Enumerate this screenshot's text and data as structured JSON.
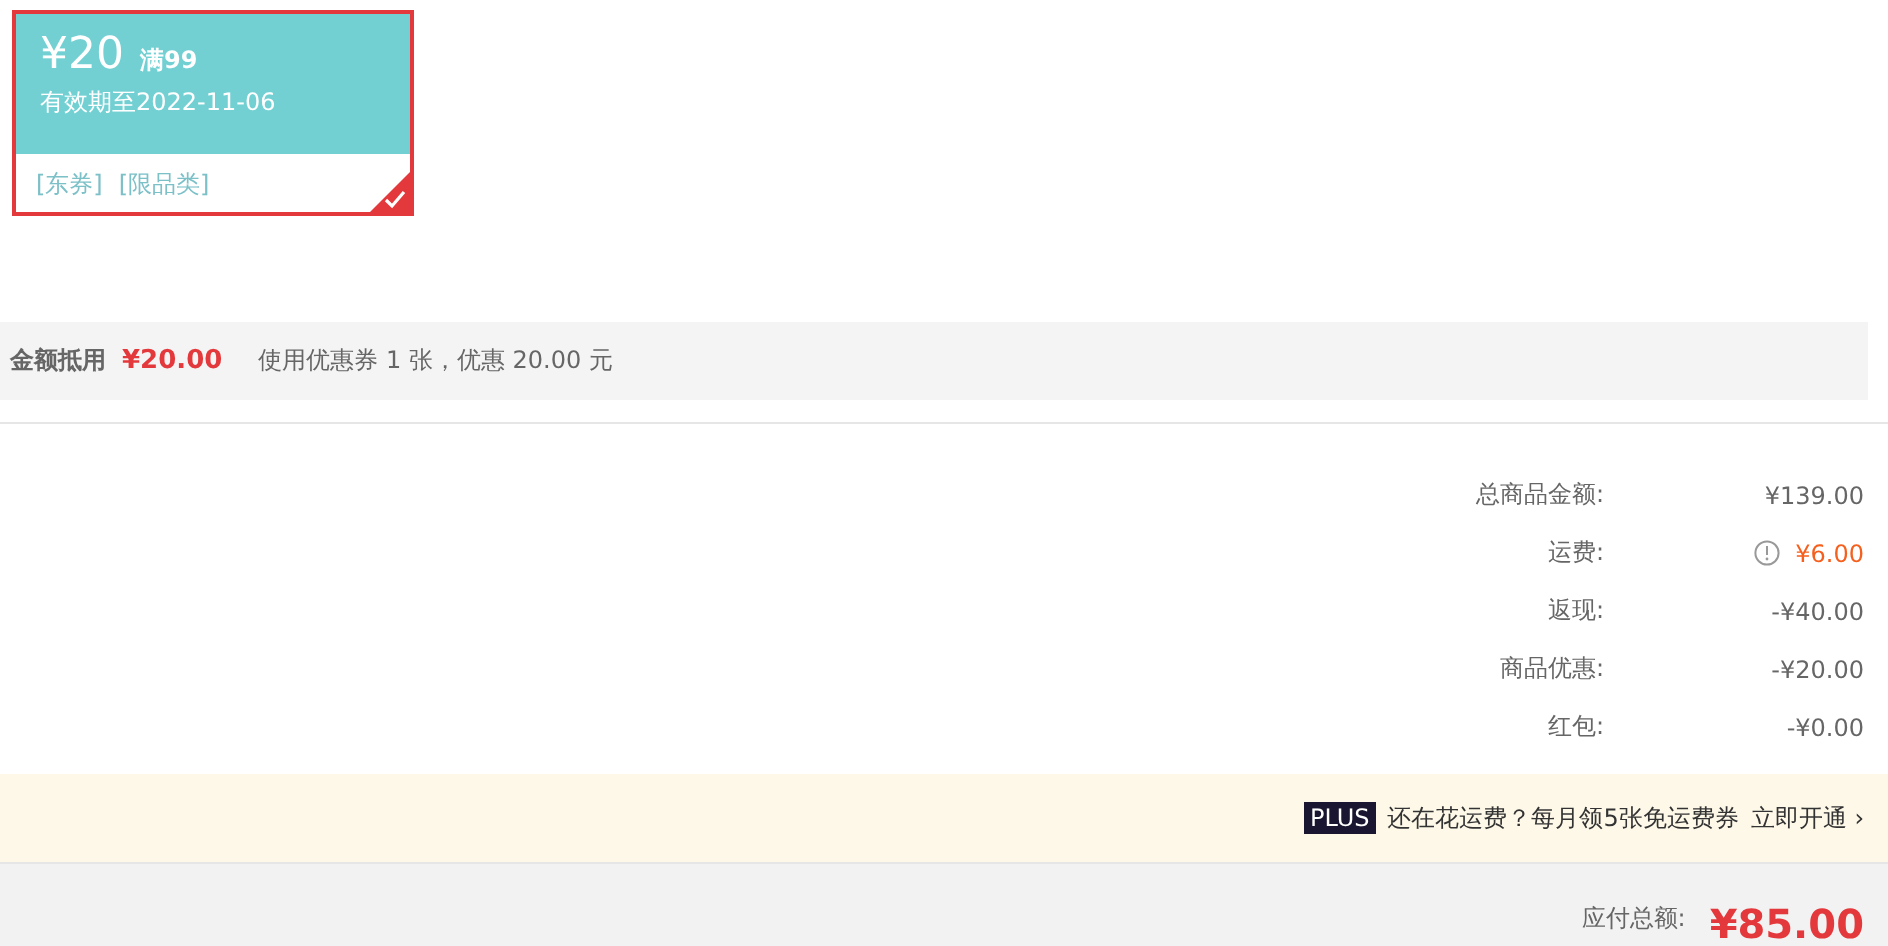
{
  "coupon": {
    "amount": "¥20",
    "condition": "满99",
    "validity": "有效期至2022-11-06",
    "tags": [
      "[东券]",
      "[限品类]"
    ],
    "selected": true
  },
  "deduction": {
    "label": "金额抵用",
    "amount": "¥20.00",
    "note": "使用优惠券 1 张，优惠 20.00 元"
  },
  "summary": [
    {
      "label": "总商品金额:",
      "value": "¥139.00",
      "kind": "plain"
    },
    {
      "label": "运费:",
      "value": "¥6.00",
      "kind": "info"
    },
    {
      "label": "返现:",
      "value": "-¥40.00",
      "kind": "plain"
    },
    {
      "label": "商品优惠:",
      "value": "-¥20.00",
      "kind": "plain"
    },
    {
      "label": "红包:",
      "value": "-¥0.00",
      "kind": "plain"
    }
  ],
  "plus_banner": {
    "badge": "PLUS",
    "text": "还在花运费？每月领5张免运费券",
    "link": "立即开通 ›"
  },
  "total": {
    "label": "应付总额:",
    "value": "¥85.00"
  }
}
